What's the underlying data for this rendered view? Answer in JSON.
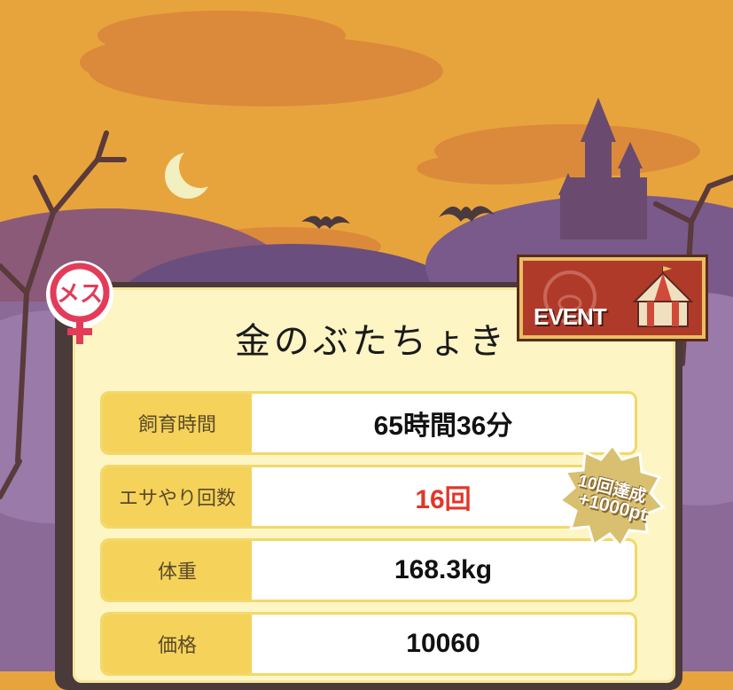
{
  "pig_name": "金のぶたちょき",
  "gender": {
    "label": "メス",
    "icon": "female-symbol-icon",
    "color": "#e23c5a"
  },
  "event_banner": {
    "label": "EVENT",
    "icon": "circus-tent-icon"
  },
  "stats": [
    {
      "label": "飼育時間",
      "value": "65時間36分",
      "highlight": false
    },
    {
      "label": "エサやり回数",
      "value": "16回",
      "highlight": true
    },
    {
      "label": "体重",
      "value": "168.3kg",
      "highlight": false
    },
    {
      "label": "価格",
      "value": "10060",
      "highlight": false
    }
  ],
  "achievement_badge": {
    "line1": "10回達成",
    "line2": "+1000pt"
  },
  "colors": {
    "sky": "#e8a43c",
    "accent_red": "#e2362a",
    "label_bg": "#f5d25a",
    "panel_bg": "#fdf5c4"
  }
}
